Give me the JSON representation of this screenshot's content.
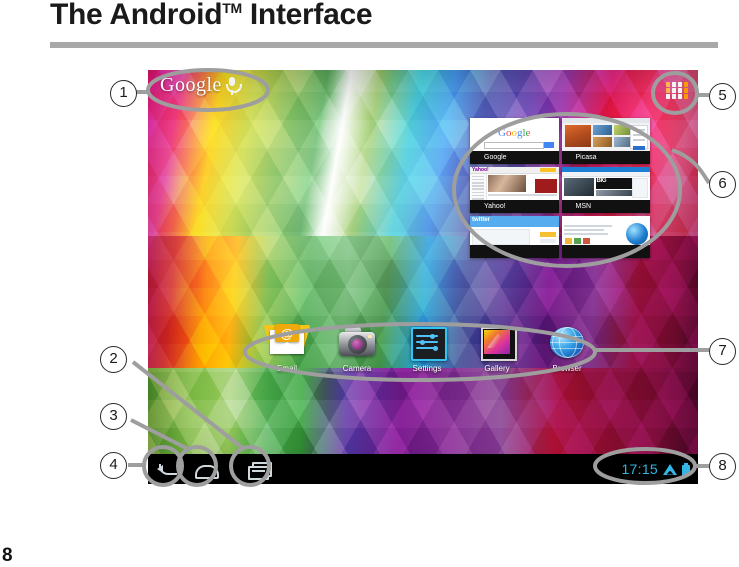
{
  "document": {
    "title": "The Android",
    "title_superscript": "TM",
    "title_suffix": " Interface",
    "page_number": "8"
  },
  "device": {
    "wallpaper_name": "colored-3d-blocks-wallpaper",
    "search": {
      "logo_text": "Google",
      "mic_icon": "microphone-icon"
    },
    "all_apps": {
      "icon": "apps-grid-icon"
    },
    "bookmarks_widget": {
      "name": "bookmarks-widget",
      "cards": [
        {
          "label": "Google",
          "favicon": "google-favicon",
          "favicon_color": "#3b5998"
        },
        {
          "label": "Picasa",
          "favicon": "picasa-favicon",
          "favicon_color": "#6aa84f"
        },
        {
          "label": "Yahoo!",
          "favicon": "yahoo-favicon",
          "favicon_color": "#7b0099"
        },
        {
          "label": "MSN",
          "favicon": "msn-favicon",
          "favicon_color": "#1c7fd4"
        },
        {
          "label": "",
          "favicon": "twitter-favicon",
          "favicon_color": "#55acee"
        },
        {
          "label": "",
          "favicon": "bing-favicon",
          "favicon_color": "#1b5fa8"
        }
      ],
      "thumbnail_texts": {
        "google_logo": "Google",
        "yahoo_logo": "Yahoo!",
        "twitter_logo": "twitter",
        "msn_big": "BIG"
      }
    },
    "apps": [
      {
        "label": "Email",
        "icon": "email-icon"
      },
      {
        "label": "Camera",
        "icon": "camera-icon"
      },
      {
        "label": "Settings",
        "icon": "settings-icon"
      },
      {
        "label": "Gallery",
        "icon": "gallery-icon"
      },
      {
        "label": "Browser",
        "icon": "browser-icon"
      }
    ],
    "navigation": [
      {
        "name": "back-button",
        "icon": "back-arrow-icon"
      },
      {
        "name": "home-button",
        "icon": "home-icon"
      },
      {
        "name": "recent-apps-button",
        "icon": "recent-apps-icon"
      }
    ],
    "status_bar": {
      "time": "17:15",
      "wifi_icon": "wifi-icon",
      "battery_icon": "battery-icon",
      "accent_color": "#33b5e5"
    }
  },
  "callouts": [
    {
      "number": "1",
      "target": "google-search-bar"
    },
    {
      "number": "2",
      "target": "recent-apps-button"
    },
    {
      "number": "3",
      "target": "home-button"
    },
    {
      "number": "4",
      "target": "back-button"
    },
    {
      "number": "5",
      "target": "all-apps-button"
    },
    {
      "number": "6",
      "target": "bookmarks-widget"
    },
    {
      "number": "7",
      "target": "app-shortcuts-row"
    },
    {
      "number": "8",
      "target": "status-bar"
    }
  ],
  "colors": {
    "rule": "#a8a8a8",
    "callout_ring": "#2b2b2b",
    "highlight_ring": "#9e9e9e",
    "text": "#1a1a1a"
  }
}
